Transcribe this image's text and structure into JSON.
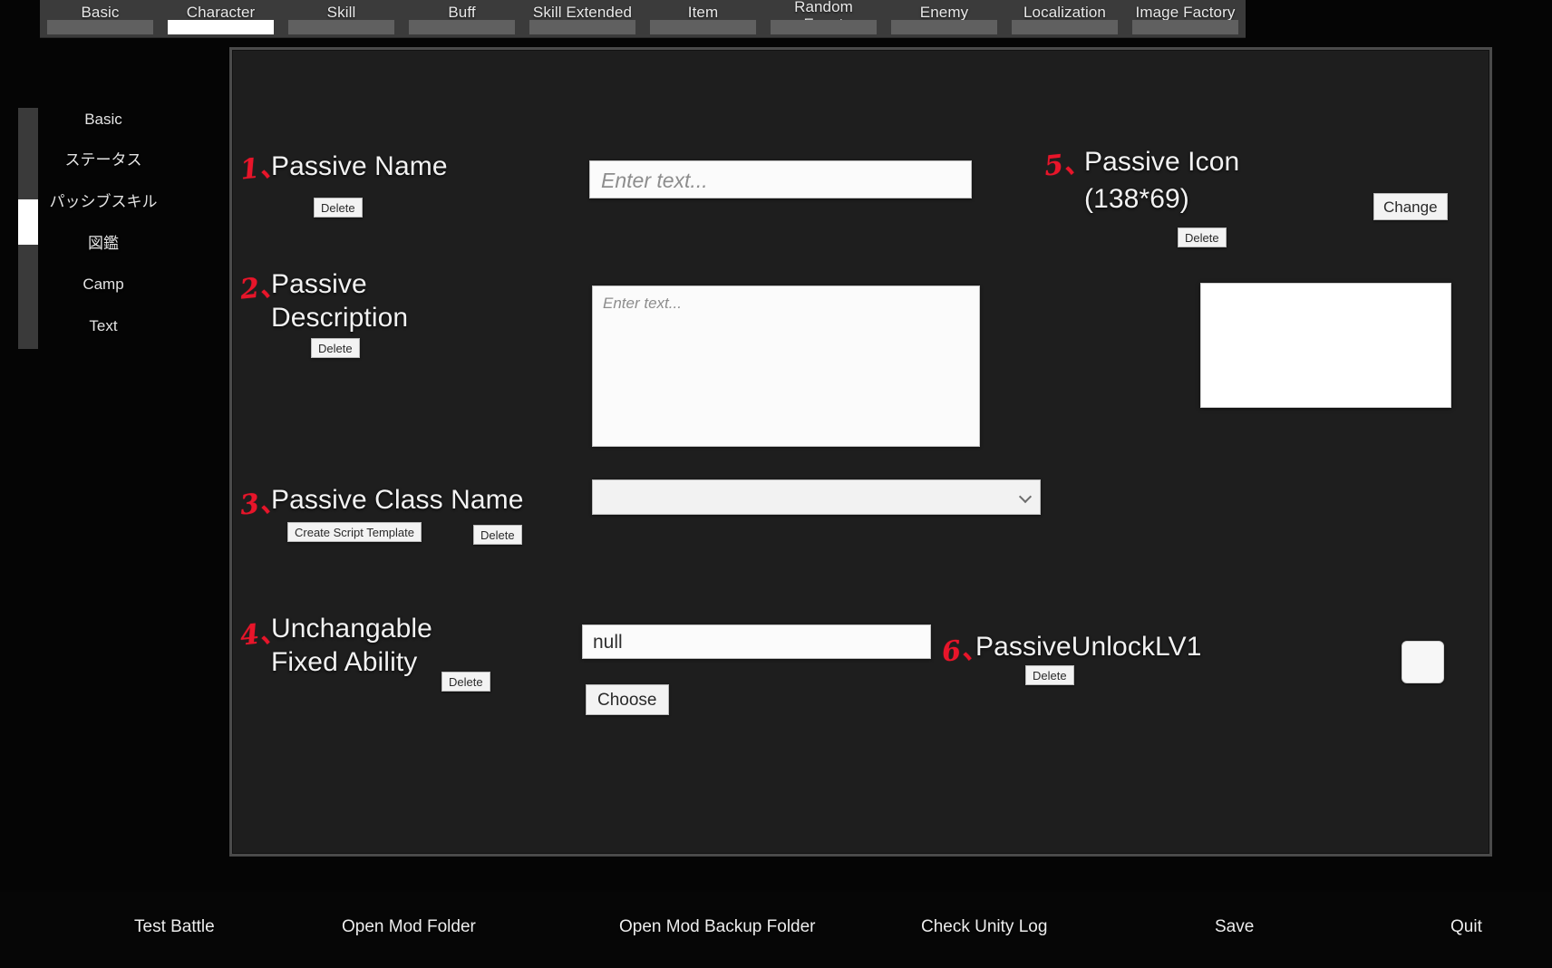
{
  "top_tabs": {
    "active": "Character",
    "items": [
      {
        "label": "Basic"
      },
      {
        "label": "Character"
      },
      {
        "label": "Skill"
      },
      {
        "label": "Buff"
      },
      {
        "label": "Skill Extended"
      },
      {
        "label": "Item"
      },
      {
        "label": "Random\nEvent"
      },
      {
        "label": "Enemy"
      },
      {
        "label": "Localization"
      },
      {
        "label": "Image Factory"
      }
    ]
  },
  "sidebar": {
    "items": [
      {
        "label": "Basic"
      },
      {
        "label": "ステータス"
      },
      {
        "label": "パッシブスキル"
      },
      {
        "label": "図鑑"
      },
      {
        "label": "Camp"
      },
      {
        "label": "Text"
      }
    ],
    "selected": "パッシブスキル"
  },
  "annotations": {
    "n1": "1、",
    "n2": "2、",
    "n3": "3、",
    "n4": "4、",
    "n5": "5、",
    "n6": "6、",
    "color": "#e8152a"
  },
  "fields": {
    "passive_name": {
      "label": "Passive Name",
      "delete_label": "Delete",
      "input_placeholder": "Enter text...",
      "input_value": ""
    },
    "passive_description": {
      "label": "Passive\nDescription",
      "delete_label": "Delete",
      "input_placeholder": "Enter text...",
      "input_value": ""
    },
    "passive_class_name": {
      "label": "Passive Class Name",
      "create_script_label": "Create Script Template",
      "delete_label": "Delete",
      "selected_option": "",
      "options": [
        ""
      ]
    },
    "unchangable_fixed_ability": {
      "label": "Unchangable\nFixed Ability",
      "delete_label": "Delete",
      "input_value": "null",
      "choose_label": "Choose"
    },
    "passive_icon": {
      "label": "Passive Icon",
      "size_label": "(138*69)",
      "change_label": "Change",
      "delete_label": "Delete"
    },
    "passive_unlock_lv1": {
      "label": "PassiveUnlockLV1",
      "delete_label": "Delete",
      "checked": false
    }
  },
  "bottom_bar": {
    "items": [
      {
        "label": "Test Battle"
      },
      {
        "label": "Open Mod Folder"
      },
      {
        "label": "Open Mod Backup Folder"
      },
      {
        "label": "Check Unity Log"
      },
      {
        "label": "Save"
      },
      {
        "label": "Quit"
      }
    ]
  }
}
